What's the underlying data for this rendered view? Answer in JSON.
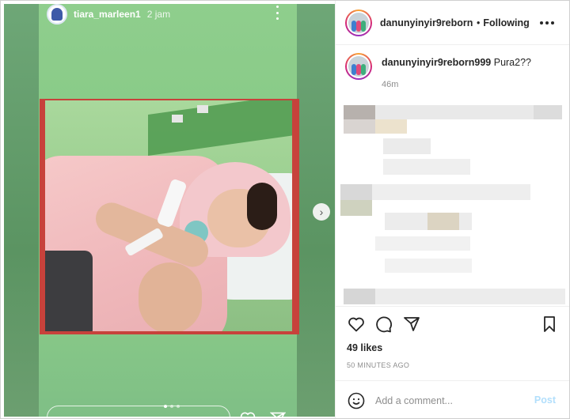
{
  "story": {
    "username": "tiara_marleen1",
    "time": "2 jam",
    "carousel_total": 3,
    "carousel_active": 1
  },
  "post": {
    "author": "danunyinyir9reborn999",
    "follow_status": "Following",
    "caption_text": "Pura2??",
    "caption_age": "46m",
    "likes": "49 likes",
    "posted": "50 MINUTES AGO",
    "comment_placeholder": "Add a comment...",
    "post_label": "Post"
  },
  "icons": {
    "more": "more-icon",
    "next": "chevron-right-icon",
    "heart": "heart-icon",
    "comment": "comment-icon",
    "share": "share-icon",
    "save": "bookmark-icon",
    "emoji": "emoji-icon"
  },
  "colors": {
    "story_green": "#8fce8d",
    "photo_border": "#c7423b",
    "post_disabled": "#b2dffc",
    "text": "#262626",
    "muted": "#8e8e8e"
  }
}
